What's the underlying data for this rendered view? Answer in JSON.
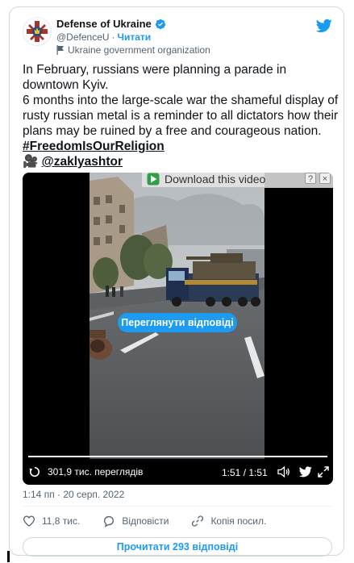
{
  "author": {
    "display_name": "Defense of Ukraine",
    "handle": "@DefenceU",
    "separator": "·",
    "follow_label": "Читати",
    "org_label": "Ukraine government organization",
    "verified_icon": "verified-badge-icon",
    "avatar_icon": "ukraine-defense-emblem-icon"
  },
  "tweet": {
    "line1": "In February, russians were planning a parade in downtown Kyiv.",
    "line2": "6 months into the large-scale war the shameful display of rusty russian metal is a reminder to all dictators how their plans may be ruined by a free and courageous nation.",
    "hashtag": "#FreedomIsOurReligion",
    "camera_emoji": "🎥",
    "mention": "@zaklyashtor"
  },
  "video": {
    "download_label": "Download this video",
    "help_label": "?",
    "close_label": "×",
    "view_replies_label": "Переглянути відповіді",
    "views_label": "301,9 тис. переглядів",
    "time_label": "1:51 / 1:51",
    "progress": 1.0
  },
  "footer": {
    "timestamp": "1:14 пп · 20 серп. 2022",
    "likes_label": "11,8 тис.",
    "reply_label": "Відповісти",
    "copy_link_label": "Копія посил.",
    "read_replies_label": "Прочитати 293 відповіді"
  },
  "colors": {
    "accent": "#1d9bf0",
    "text": "#0f1419",
    "muted": "#536471",
    "border": "#cfd9de"
  }
}
